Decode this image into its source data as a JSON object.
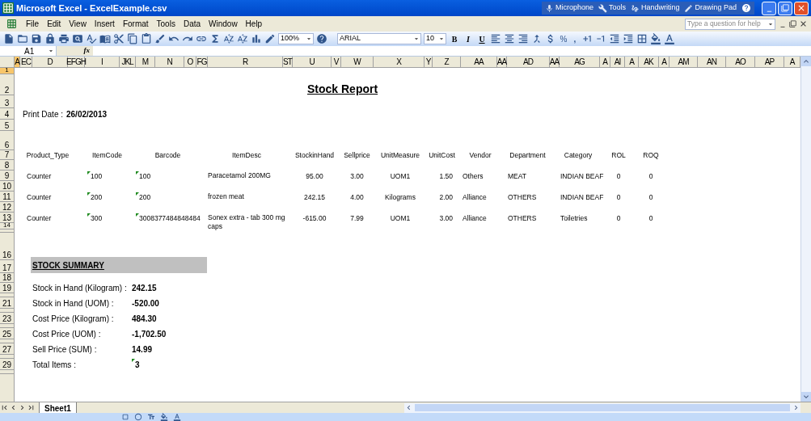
{
  "window": {
    "title": "Microsoft Excel - ExcelExample.csv"
  },
  "language_bar": [
    "Microphone",
    "Tools",
    "Handwriting",
    "Drawing Pad"
  ],
  "menu": [
    "File",
    "Edit",
    "View",
    "Insert",
    "Format",
    "Tools",
    "Data",
    "Window",
    "Help"
  ],
  "help_box": {
    "placeholder": "Type a question for help"
  },
  "toolbar": {
    "zoom": "100%",
    "font": "ARIAL",
    "font_size": "10",
    "bold": "B",
    "italic": "I",
    "underline": "U",
    "percent": "%",
    "comma": ","
  },
  "formula_bar": {
    "name_box": "A1",
    "function_label": "fx"
  },
  "column_headers": [
    {
      "label": "A",
      "selected": true
    },
    {
      "label": "EC",
      "selected": false
    },
    {
      "label": "D",
      "selected": false
    },
    {
      "label": "EFGH",
      "selected": false
    },
    {
      "label": "I",
      "selected": false
    },
    {
      "label": "JKL",
      "selected": false
    },
    {
      "label": "M",
      "selected": false
    },
    {
      "label": "N",
      "selected": false
    },
    {
      "label": "O",
      "selected": false
    },
    {
      "label": "FG",
      "selected": false
    },
    {
      "label": "R",
      "selected": false
    },
    {
      "label": "ST",
      "selected": false
    },
    {
      "label": "U",
      "selected": false
    },
    {
      "label": "V",
      "selected": false
    },
    {
      "label": "W",
      "selected": false
    },
    {
      "label": "X",
      "selected": false
    },
    {
      "label": "Y",
      "selected": false
    },
    {
      "label": "Z",
      "selected": false
    },
    {
      "label": "AA",
      "selected": false
    },
    {
      "label": "AA",
      "selected": false
    },
    {
      "label": "AD",
      "selected": false
    },
    {
      "label": "AA",
      "selected": false
    },
    {
      "label": "AG",
      "selected": false
    },
    {
      "label": "A",
      "selected": false
    },
    {
      "label": "AI",
      "selected": false
    },
    {
      "label": "A",
      "selected": false
    },
    {
      "label": "AK",
      "selected": false
    },
    {
      "label": "A",
      "selected": false
    },
    {
      "label": "AM",
      "selected": false
    },
    {
      "label": "AN",
      "selected": false
    },
    {
      "label": "AO",
      "selected": false
    },
    {
      "label": "AP",
      "selected": false
    },
    {
      "label": "A",
      "selected": false
    }
  ],
  "row_headers": [
    {
      "label": "1",
      "selected": true
    },
    {
      "label": "2",
      "selected": false
    },
    {
      "label": "3",
      "selected": false
    },
    {
      "label": "4",
      "selected": false
    },
    {
      "label": "5",
      "selected": false
    },
    {
      "label": "6",
      "selected": false
    },
    {
      "label": "7",
      "selected": false
    },
    {
      "label": "8",
      "selected": false
    },
    {
      "label": "9",
      "selected": false
    },
    {
      "label": "10",
      "selected": false
    },
    {
      "label": "11",
      "selected": false
    },
    {
      "label": "12",
      "selected": false
    },
    {
      "label": "13",
      "selected": false
    },
    {
      "label": "14",
      "selected": false
    },
    {
      "label": "16",
      "selected": false
    },
    {
      "label": "17",
      "selected": false
    },
    {
      "label": "18",
      "selected": false
    },
    {
      "label": "19",
      "selected": false
    },
    {
      "label": "21",
      "selected": false
    },
    {
      "label": "23",
      "selected": false
    },
    {
      "label": "25",
      "selected": false
    },
    {
      "label": "27",
      "selected": false
    },
    {
      "label": "29",
      "selected": false
    }
  ],
  "report": {
    "title": "Stock Report",
    "print_date_label": "Print Date :",
    "print_date": "26/02/2013",
    "columns": [
      "Product_Type",
      "ItemCode",
      "Barcode",
      "ItemDesc",
      "StockinHand",
      "Sellprice",
      "UnitMeasure",
      "UnitCost",
      "Vendor",
      "Department",
      "Category",
      "ROL",
      "ROQ"
    ],
    "rows": [
      {
        "cells": [
          {
            "text": "Counter",
            "flag": false
          },
          {
            "text": "100",
            "flag": true
          },
          {
            "text": "100",
            "flag": true
          },
          {
            "text": "Paracetamol 200MG",
            "flag": false
          },
          {
            "text": "95.00",
            "flag": false
          },
          {
            "text": "3.00",
            "flag": false
          },
          {
            "text": "UOM1",
            "flag": false
          },
          {
            "text": "1.50",
            "flag": false
          },
          {
            "text": "Others",
            "flag": false
          },
          {
            "text": "MEAT",
            "flag": false
          },
          {
            "text": "INDIAN BEAF",
            "flag": false
          },
          {
            "text": "0",
            "flag": false
          },
          {
            "text": "0",
            "flag": false
          }
        ]
      },
      {
        "cells": [
          {
            "text": "Counter",
            "flag": false
          },
          {
            "text": "200",
            "flag": true
          },
          {
            "text": "200",
            "flag": true
          },
          {
            "text": "frozen meat",
            "flag": false
          },
          {
            "text": "242.15",
            "flag": false
          },
          {
            "text": "4.00",
            "flag": false
          },
          {
            "text": "Kilograms",
            "flag": false
          },
          {
            "text": "2.00",
            "flag": false
          },
          {
            "text": "Alliance",
            "flag": false
          },
          {
            "text": "OTHERS",
            "flag": false
          },
          {
            "text": "INDIAN BEAF",
            "flag": false
          },
          {
            "text": "0",
            "flag": false
          },
          {
            "text": "0",
            "flag": false
          }
        ]
      },
      {
        "cells": [
          {
            "text": "Counter",
            "flag": false
          },
          {
            "text": "300",
            "flag": true
          },
          {
            "text": "3008377484848484",
            "flag": true
          },
          {
            "text": "Sonex extra - tab 300 mg caps",
            "flag": false
          },
          {
            "text": "-615.00",
            "flag": false
          },
          {
            "text": "7.99",
            "flag": false
          },
          {
            "text": "UOM1",
            "flag": false
          },
          {
            "text": "3.00",
            "flag": false
          },
          {
            "text": "Alliance",
            "flag": false
          },
          {
            "text": "OTHERS",
            "flag": false
          },
          {
            "text": "Toiletries",
            "flag": false
          },
          {
            "text": "0",
            "flag": false
          },
          {
            "text": "0",
            "flag": false
          }
        ]
      }
    ]
  },
  "summary": {
    "title": "STOCK SUMMARY",
    "items": [
      {
        "label": "Stock in Hand (Kilogram) :",
        "value": "242.15",
        "flag": false
      },
      {
        "label": "Stock in Hand (UOM) :",
        "value": "-520.00",
        "flag": false
      },
      {
        "label": "Cost Price (Kilogram) :",
        "value": "484.30",
        "flag": false
      },
      {
        "label": "Cost Price (UOM) :",
        "value": "-1,702.50",
        "flag": false
      },
      {
        "label": "Sell Price (SUM) :",
        "value": "14.99",
        "flag": false
      },
      {
        "label": "Total Items :",
        "value": "3",
        "flag": true
      }
    ]
  },
  "sheet_tabs": [
    {
      "label": "Sheet1",
      "selected": true
    }
  ]
}
